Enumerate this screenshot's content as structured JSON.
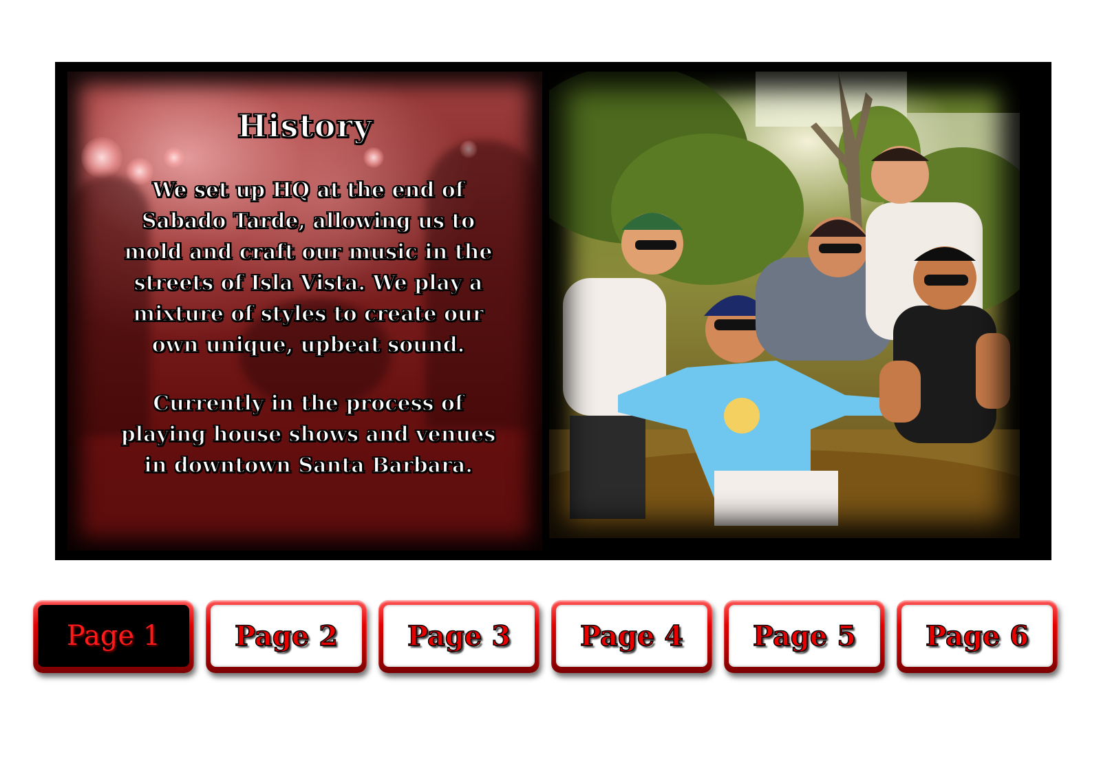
{
  "history": {
    "title": "History",
    "paragraph1": "We set up HQ at the end of\nSabado Tarde, allowing us to\nmold and craft our music in the\nstreets of Isla Vista. We play a\nmixture of styles to create our\nown unique, upbeat sound.",
    "paragraph2": "Currently in the process of\nplaying house shows and venues\nin downtown Santa Barbara."
  },
  "pagination": {
    "current_page": 1,
    "pages": [
      {
        "label": "Page 1"
      },
      {
        "label": "Page 2"
      },
      {
        "label": "Page 3"
      },
      {
        "label": "Page 4"
      },
      {
        "label": "Page 5"
      },
      {
        "label": "Page 6"
      }
    ]
  },
  "colors": {
    "accent": "#e00000",
    "panel_background": "#000000",
    "card_tint": "#7d1f1f"
  }
}
